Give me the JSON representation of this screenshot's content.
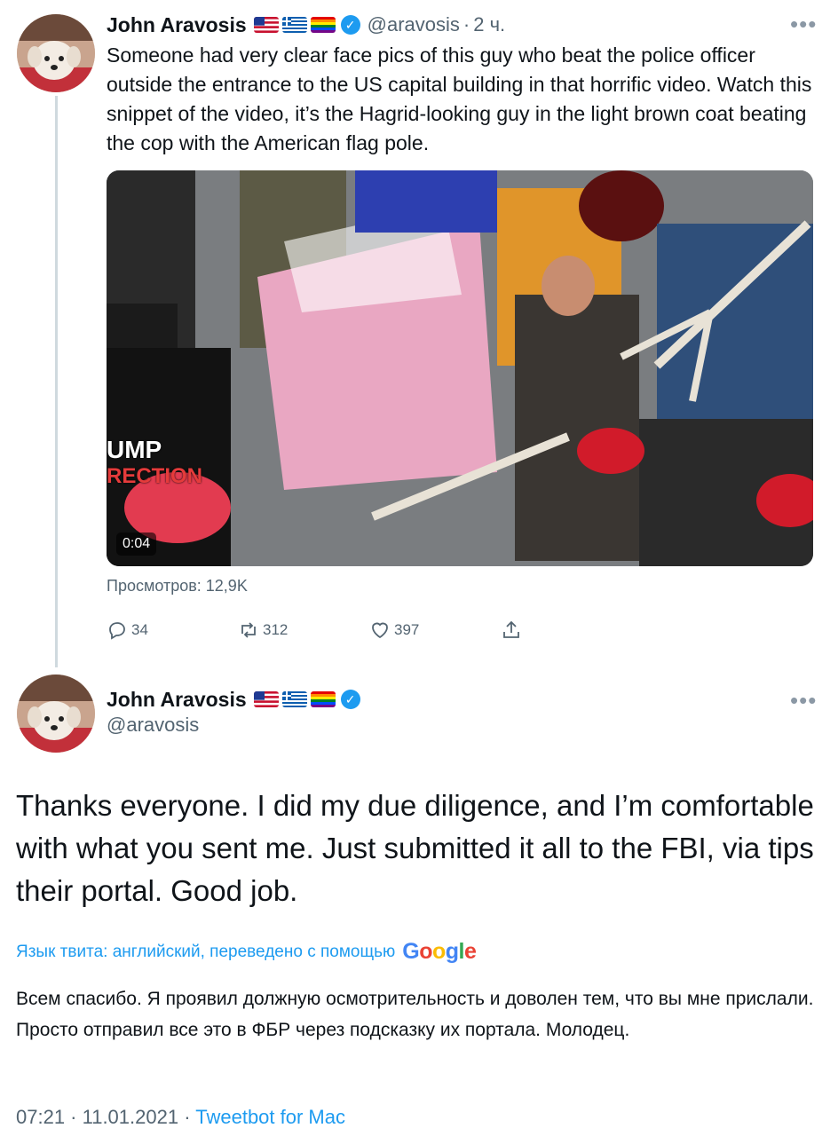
{
  "tweet1": {
    "name": "John Aravosis",
    "flags": [
      "us-flag",
      "greece-flag",
      "rainbow-flag"
    ],
    "handle": "@aravosis",
    "separator": "·",
    "time": "2 ч.",
    "text": "Someone had very clear face pics of this guy who beat the police officer outside the entrance to the US capital building in that horrific video. Watch this snippet of the video, it’s the Hagrid-looking guy in the light brown coat beating the cop with the American flag pole.",
    "video": {
      "duration": "0:04",
      "overlay_text_line1": "UMP",
      "overlay_text_line2": "RECTION"
    },
    "views": "Просмотров: 12,9K",
    "actions": {
      "replies": "34",
      "retweets": "312",
      "likes": "397"
    }
  },
  "tweet2": {
    "name": "John Aravosis",
    "flags": [
      "us-flag",
      "greece-flag",
      "rainbow-flag"
    ],
    "handle": "@aravosis",
    "text": "Thanks everyone. I did my due diligence, and I’m comfortable with what you sent me. Just submitted it all to the FBI, via tips their portal. Good job.",
    "translation_label": "Язык твита: английский, переведено с помощью",
    "translator": "Google",
    "translated_text": "Всем спасибо. Я проявил должную осмотрительность и доволен тем, что вы мне прислали. Просто отправил все это в ФБР через подсказку их портала. Молодец.",
    "date_time": "07:21 · 11.01.2021 ·",
    "client": "Tweetbot for Mac"
  },
  "colors": {
    "accent": "#1d9bf0",
    "secondary_text": "#536471",
    "primary_text": "#0f1419",
    "thread_line": "#cfd9de"
  }
}
